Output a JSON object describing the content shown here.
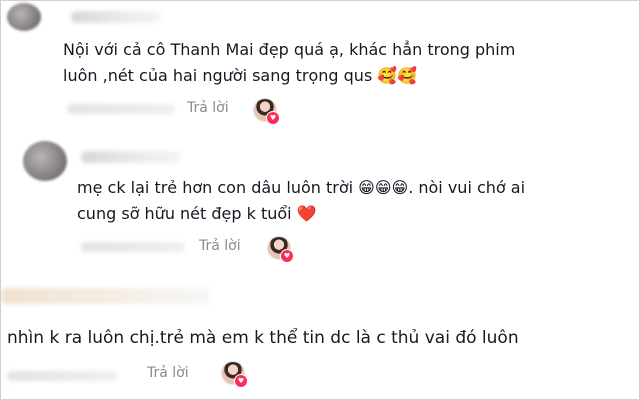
{
  "comments": [
    {
      "line1": "Nội với cả cô Thanh Mai đẹp quá ạ, khác hẳn trong phim",
      "line2": "luôn ,nét của hai người sang trọng qus 🥰🥰",
      "reply_label": "Trả lời",
      "creator_liked_icon": "heart-icon"
    },
    {
      "line1": "mẹ ck lại trẻ hơn con dâu luôn trời 😁😁😁. nòi vui chớ ai",
      "line2": "cung sỡ hữu nét đẹp k tuổi ❤️",
      "reply_label": "Trả lời",
      "creator_liked_icon": "heart-icon"
    },
    {
      "line1": "nhìn k ra luôn chị.trẻ mà em k thể tin dc là c thủ vai đó luôn",
      "reply_label": "Trả lời",
      "creator_liked_icon": "heart-icon"
    }
  ],
  "colors": {
    "text": "#161823",
    "meta": "#8a8b91",
    "like_badge": "#fe2c55"
  }
}
